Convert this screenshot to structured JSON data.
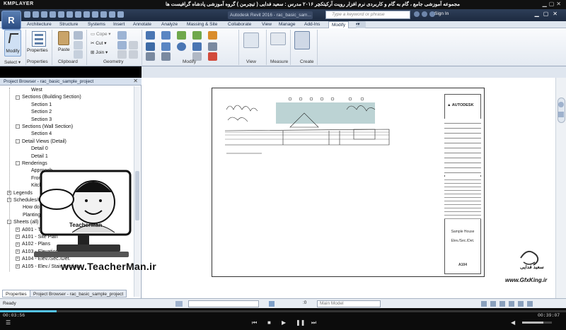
{
  "kmplayer": {
    "brand": "KMPLAYER",
    "title": "مجموعه آموزشی جامع ، گام به گام و کاربردی نرم افزار رویت آرکیتکچر ۲۰۱۶   مدرس : سعید فدایی ( تیچرمن ) گروه آموزشی پادشاه گرافیست ها",
    "time_elapsed": "00:03:56",
    "time_total": "00:39:07",
    "progress_fraction": 0.1,
    "volume_fraction": 0.72
  },
  "revit": {
    "app_button": "R",
    "app_title": "Autodesk Revit 2016 - rac_basic_sam...",
    "search_placeholder": "Type a keyword or phrase",
    "sign_in": "Sign In",
    "tabs": [
      "Architecture",
      "Structure",
      "Systems",
      "Insert",
      "Annotate",
      "Analyze",
      "Massing & Site",
      "Collaborate",
      "View",
      "Manage",
      "Add-Ins",
      "Modify"
    ],
    "active_tab": "Modify",
    "ribbon": {
      "modify": "Modify",
      "select": "Select",
      "properties": "Properties",
      "paste": "Paste",
      "clipboard": "Clipboard",
      "cope": "Cope",
      "cut": "Cut",
      "join": "Join",
      "geometry": "Geometry",
      "modify_panel": "Modify",
      "view": "View",
      "measure": "Measure",
      "create": "Create"
    }
  },
  "project_browser": {
    "title": "Project Browser - rac_basic_sample_project",
    "items": [
      {
        "label": "West",
        "level": 3,
        "exp": ""
      },
      {
        "label": "Sections (Building Section)",
        "level": 2,
        "exp": "-"
      },
      {
        "label": "Section 1",
        "level": 3,
        "exp": ""
      },
      {
        "label": "Section 2",
        "level": 3,
        "exp": ""
      },
      {
        "label": "Section 3",
        "level": 3,
        "exp": ""
      },
      {
        "label": "Sections (Wall Section)",
        "level": 2,
        "exp": "-"
      },
      {
        "label": "Section 4",
        "level": 3,
        "exp": ""
      },
      {
        "label": "Detail Views (Detail)",
        "level": 2,
        "exp": "-"
      },
      {
        "label": "Detail 0",
        "level": 3,
        "exp": ""
      },
      {
        "label": "Detail 1",
        "level": 3,
        "exp": ""
      },
      {
        "label": "Renderings",
        "level": 2,
        "exp": "-"
      },
      {
        "label": "Approach",
        "level": 3,
        "exp": ""
      },
      {
        "label": "From Yard",
        "level": 3,
        "exp": ""
      },
      {
        "label": "Kitchen",
        "level": 3,
        "exp": ""
      },
      {
        "label": "Legends",
        "level": 1,
        "exp": "+"
      },
      {
        "label": "Schedules/Quantities",
        "level": 1,
        "exp": "-"
      },
      {
        "label": "How do I",
        "level": 2,
        "exp": ""
      },
      {
        "label": "Planting Schedule",
        "level": 2,
        "exp": ""
      },
      {
        "label": "Sheets (all)",
        "level": 1,
        "exp": "-"
      },
      {
        "label": "A001 - Title Sheet",
        "level": 2,
        "exp": "+"
      },
      {
        "label": "A101 - Site Plan",
        "level": 2,
        "exp": "+"
      },
      {
        "label": "A102 - Plans",
        "level": 2,
        "exp": "+"
      },
      {
        "label": "A103 - Elevations/Sections",
        "level": 2,
        "exp": "+"
      },
      {
        "label": "A104 - Elev./Sec./Det.",
        "level": 2,
        "exp": "+"
      },
      {
        "label": "A105 - Elev./ Stair Sections",
        "level": 2,
        "exp": "+"
      }
    ],
    "bottom_tabs": [
      "Properties",
      "Project Browser - rac_basic_sample_project"
    ]
  },
  "title_block": {
    "logo": "AUTODESK",
    "project": "Sample House",
    "sheet_name": "Elev./Sec./Det.",
    "sheet_number": "A104"
  },
  "overlay": {
    "teacherman_logo": "TeacherMan",
    "teacherman_site": "www.TeacherMan.ir",
    "gfx_name": "سعید فدایی",
    "gfx_site": "www.GfxKing.ir"
  },
  "status": {
    "ready": "Ready",
    "zero": ":0",
    "model": "Main Model"
  }
}
